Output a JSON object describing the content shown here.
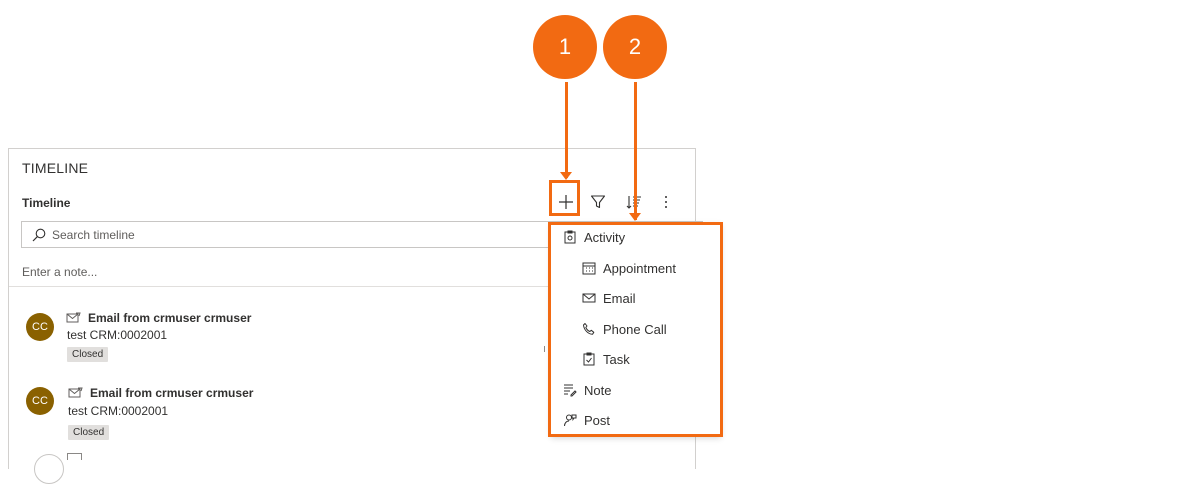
{
  "timeline": {
    "heading": "TIMELINE",
    "subtitle": "Timeline",
    "search_placeholder": "Search timeline",
    "note_placeholder": "Enter a note...",
    "toolbar": {
      "create_icon": "plus-icon",
      "filter_icon": "filter-icon",
      "sort_icon": "sort-icon",
      "more_icon": "more-vertical-icon"
    },
    "items": [
      {
        "avatar_initials": "CC",
        "type_icon": "email-icon",
        "title": "Email from crmuser crmuser",
        "subtitle": "test CRM:0002001",
        "status": "Closed"
      },
      {
        "avatar_initials": "CC",
        "type_icon": "email-icon",
        "title": "Email from crmuser crmuser",
        "subtitle": "test CRM:0002001",
        "status": "Closed"
      }
    ]
  },
  "menu": {
    "items": [
      {
        "label": "Activity",
        "icon": "activity-icon",
        "indent": false
      },
      {
        "label": "Appointment",
        "icon": "calendar-icon",
        "indent": true
      },
      {
        "label": "Email",
        "icon": "email-icon",
        "indent": true
      },
      {
        "label": "Phone Call",
        "icon": "phone-icon",
        "indent": true
      },
      {
        "label": "Task",
        "icon": "task-icon",
        "indent": true
      },
      {
        "label": "Note",
        "icon": "note-icon",
        "indent": false
      },
      {
        "label": "Post",
        "icon": "post-icon",
        "indent": false
      }
    ]
  },
  "annotations": {
    "callout_1": "1",
    "callout_2": "2",
    "accent_color": "#f26a12"
  },
  "colors": {
    "avatar_bg": "#8a6100",
    "badge_bg": "#e1dfdd",
    "border": "#d2d0ce"
  }
}
